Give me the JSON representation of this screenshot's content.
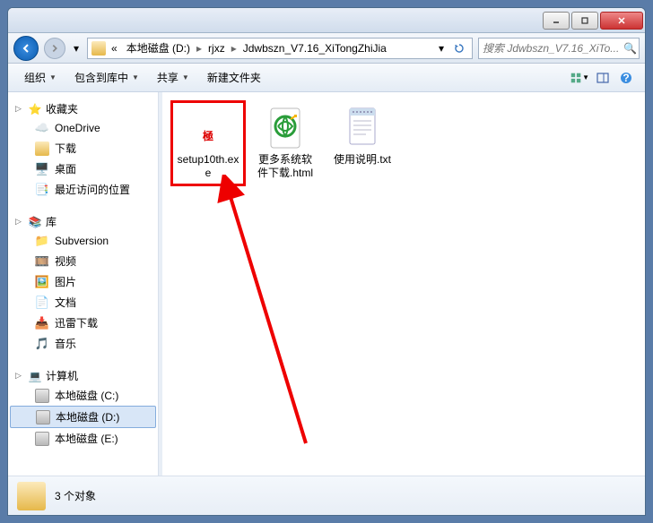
{
  "breadcrumb": {
    "prefix": "«",
    "items": [
      "本地磁盘 (D:)",
      "rjxz",
      "Jdwbszn_V7.16_XiTongZhiJia"
    ]
  },
  "search": {
    "placeholder": "搜索 Jdwbszn_V7.16_XiTo..."
  },
  "toolbar": {
    "organize": "组织",
    "include": "包含到库中",
    "share": "共享",
    "newfolder": "新建文件夹"
  },
  "sidebar": {
    "favorites": {
      "label": "收藏夹",
      "items": [
        "OneDrive",
        "下载",
        "桌面",
        "最近访问的位置"
      ]
    },
    "libraries": {
      "label": "库",
      "items": [
        "Subversion",
        "视频",
        "图片",
        "文档",
        "迅雷下载",
        "音乐"
      ]
    },
    "computer": {
      "label": "计算机",
      "items": [
        "本地磁盘 (C:)",
        "本地磁盘 (D:)",
        "本地磁盘 (E:)"
      ]
    }
  },
  "files": [
    {
      "name": "setup10th.exe",
      "type": "exe"
    },
    {
      "name": "更多系统软件下载.html",
      "type": "html"
    },
    {
      "name": "使用说明.txt",
      "type": "txt"
    }
  ],
  "status": {
    "count": "3 个对象"
  }
}
